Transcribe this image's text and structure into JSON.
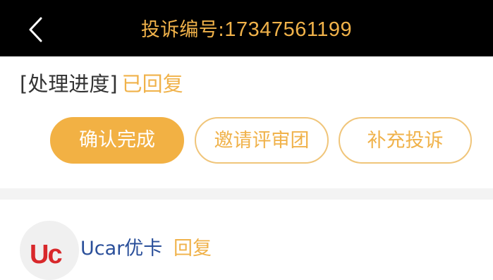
{
  "header": {
    "back_icon": "chevron-left-icon",
    "title_prefix": "投诉编号:",
    "title_number": "17347561199"
  },
  "progress": {
    "label": "[处理进度]",
    "status": "已回复"
  },
  "actions": {
    "confirm_label": "确认完成",
    "invite_label": "邀请评审团",
    "supplement_label": "补充投诉"
  },
  "reply": {
    "avatar_logo": "Uc",
    "name": "Ucar优卡",
    "action": "回复"
  },
  "colors": {
    "accent": "#f0b24a",
    "header_bg": "#000000",
    "link_blue": "#2a4f9a",
    "logo_red": "#d8282b"
  }
}
